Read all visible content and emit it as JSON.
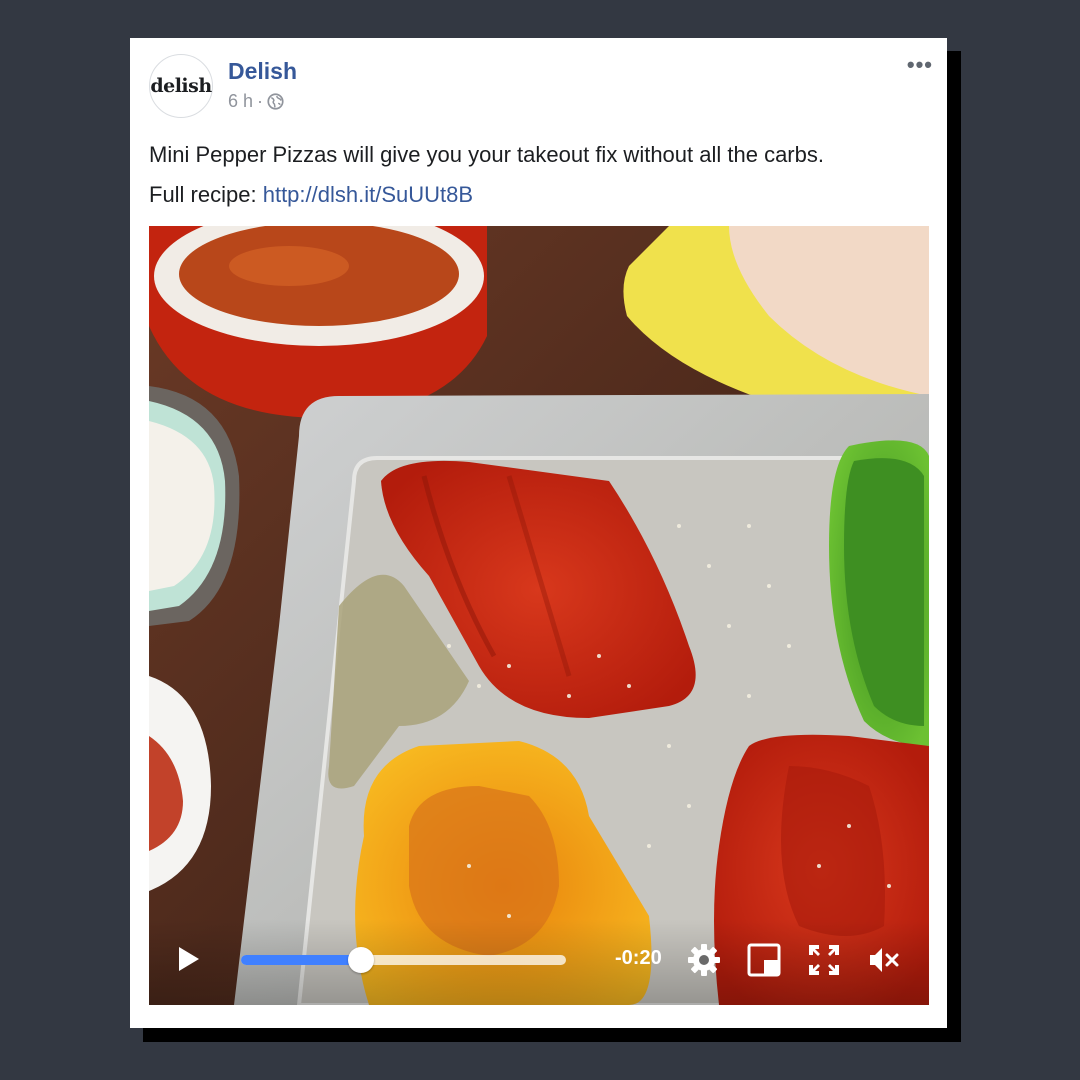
{
  "post": {
    "avatar_text": "delish",
    "page_name": "Delish",
    "time": "6 h",
    "separator": "·",
    "privacy_icon": "globe-icon",
    "more_label": "•••",
    "text_line1": "Mini Pepper Pizzas will give you your takeout fix without all the carbs.",
    "text_line2_prefix": "Full recipe: ",
    "link": "http://dlsh.it/SuUUt8B"
  },
  "video": {
    "progress": 0.37,
    "time_remaining": "-0:20",
    "controls": [
      "play-icon",
      "settings-gear-icon",
      "picture-in-picture-icon",
      "fullscreen-icon",
      "mute-icon"
    ]
  },
  "colors": {
    "link": "#365899",
    "progress": "#4080ff",
    "page_background": "#333842"
  }
}
